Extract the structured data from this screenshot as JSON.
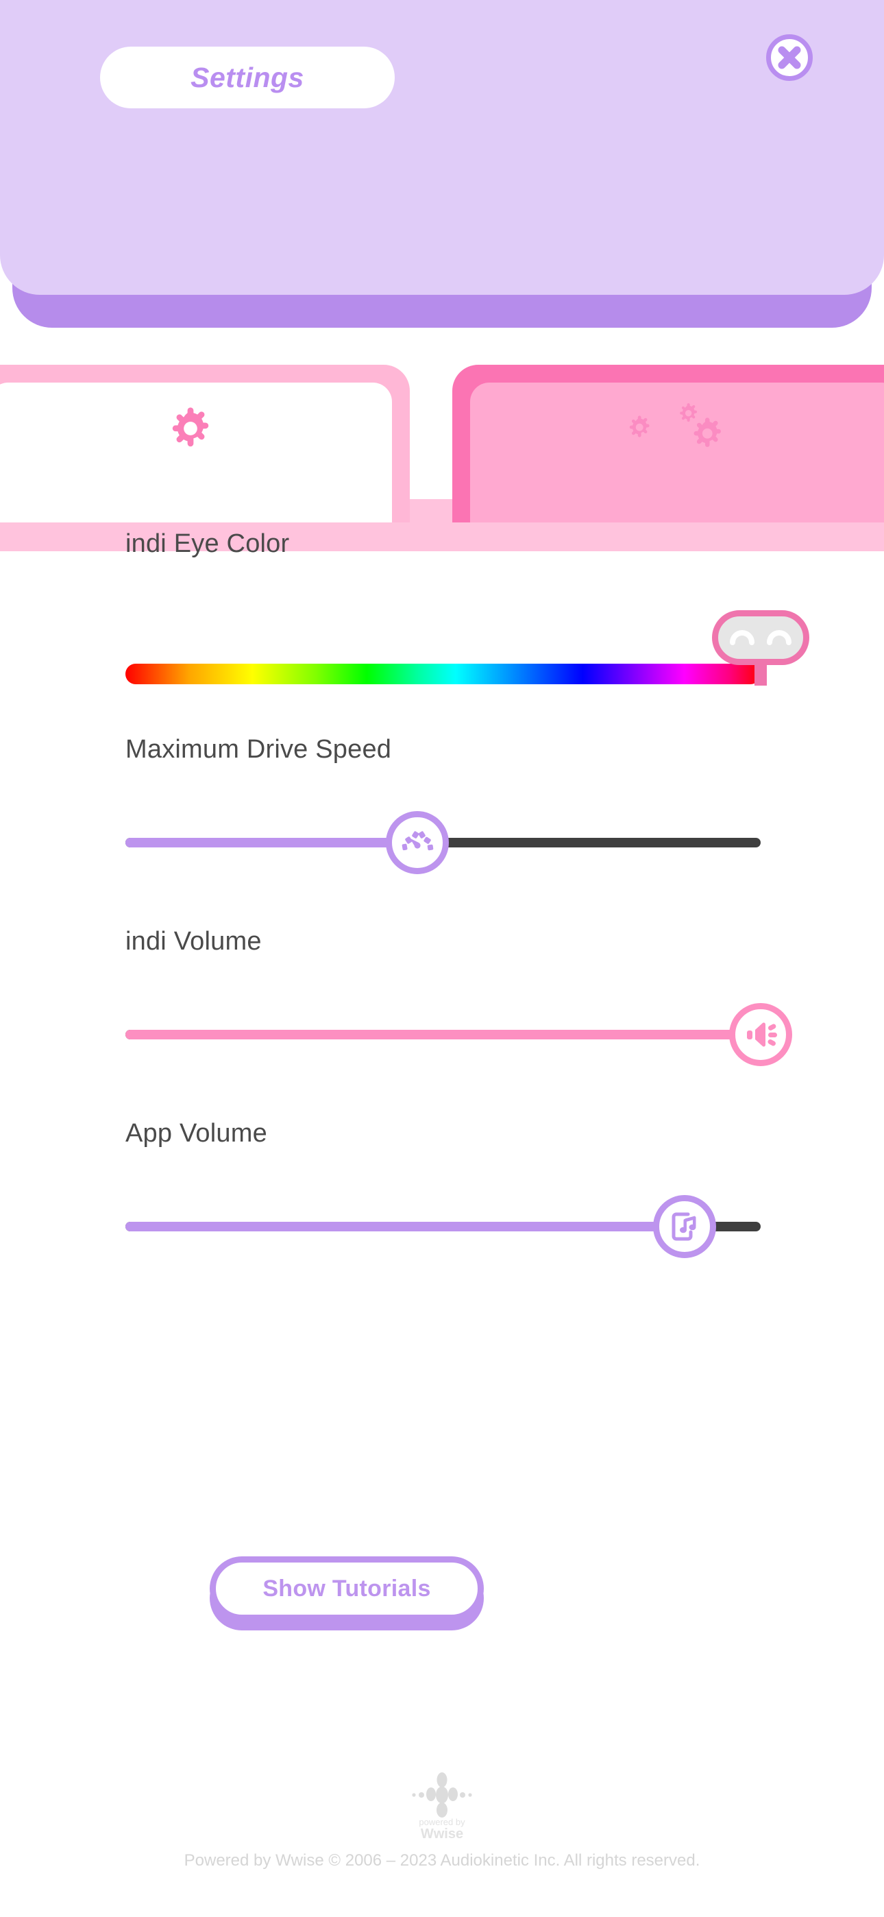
{
  "header": {
    "title": "Settings",
    "close_icon": "close-x-icon",
    "panel_color": "#e0ccf8",
    "base_color": "#b68ceb",
    "accent_color": "#b98ef0"
  },
  "tabs": [
    {
      "id": "general",
      "icon": "single-gear-icon",
      "active": true,
      "color": "#ffb7d6",
      "icon_color": "#fb7fb8"
    },
    {
      "id": "advanced",
      "icon": "multi-gear-icon",
      "active": false,
      "color": "#fb74b3",
      "icon_color": "#fb8cc2"
    }
  ],
  "settings": [
    {
      "id": "indi-eye-color",
      "label": "indi Eye Color",
      "control": "color-slider",
      "thumb_icon": "eyes-icon",
      "value_pct": 100,
      "track_style": "rainbow-gradient",
      "thumb_color": "#ef75ad"
    },
    {
      "id": "maximum-drive-speed",
      "label": "Maximum Drive Speed",
      "control": "slider",
      "thumb_icon": "speedometer-icon",
      "value_pct": 46,
      "fill_color": "#bd94ee",
      "track_color": "#3f3f3f"
    },
    {
      "id": "indi-volume",
      "label": "indi Volume",
      "control": "slider",
      "thumb_icon": "speaker-volume-icon",
      "value_pct": 100,
      "fill_color": "#fd8fc1",
      "track_color": "#3f3f3f"
    },
    {
      "id": "app-volume",
      "label": "App Volume",
      "control": "slider",
      "thumb_icon": "phone-music-icon",
      "value_pct": 88,
      "fill_color": "#bd94ee",
      "track_color": "#3f3f3f"
    }
  ],
  "actions": {
    "show_tutorials_label": "Show Tutorials"
  },
  "footer": {
    "logo": "wwise-logo",
    "logo_tagline_top": "powered by",
    "logo_wordmark": "Wwise",
    "copyright": "Powered by Wwise © 2006 – 2023 Audiokinetic Inc. All rights reserved."
  }
}
